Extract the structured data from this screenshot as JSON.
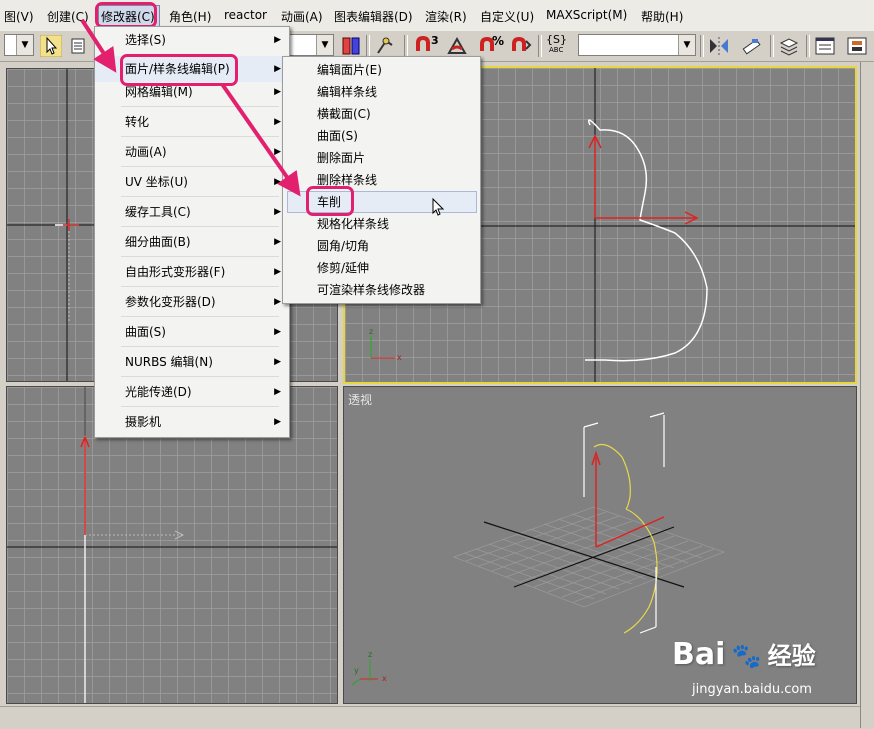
{
  "menubar": {
    "items": [
      "图(V)",
      "创建(C)",
      "修改器(C)",
      "角色(H)",
      "reactor",
      "动画(A)",
      "图表编辑器(D)",
      "渲染(R)",
      "自定义(U)",
      "MAXScript(M)",
      "帮助(H)"
    ]
  },
  "modifier_menu": {
    "items": [
      "选择(S)",
      "面片/样条线编辑(P)",
      "网格编辑(M)",
      "转化",
      "动画(A)",
      "UV 坐标(U)",
      "缓存工具(C)",
      "细分曲面(B)",
      "自由形式变形器(F)",
      "参数化变形器(D)",
      "曲面(S)",
      "NURBS 编辑(N)",
      "光能传递(D)",
      "摄影机"
    ]
  },
  "submenu": {
    "items": [
      "编辑面片(E)",
      "编辑样条线",
      "横截面(C)",
      "曲面(S)",
      "删除面片",
      "删除样条线",
      "车削",
      "规格化样条线",
      "圆角/切角",
      "修剪/延伸",
      "可渲染样条线修改器"
    ],
    "highlighted_index": 6
  },
  "toolbar": {
    "text_a": "3",
    "text_b": "%",
    "text_c": "{S}",
    "text_d": "ABC"
  },
  "viewports": {
    "perspective_label": "透视"
  },
  "watermark": {
    "logo_text": "Bai",
    "logo_suffix": "经验",
    "url": "jingyan.baidu.com"
  },
  "colors": {
    "highlight": "#e2206e",
    "active_viewport": "#e7d73d",
    "spline_white": "#ffffff",
    "spline_yellow": "#e8d84a"
  }
}
